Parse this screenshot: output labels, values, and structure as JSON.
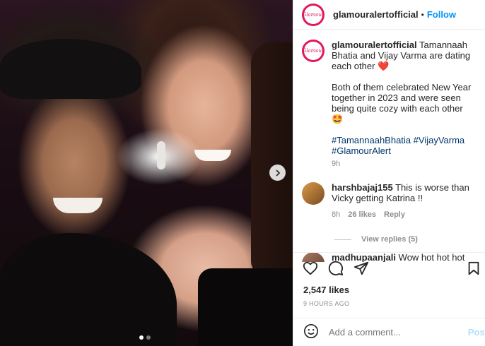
{
  "post": {
    "username": "glamouralertofficial",
    "separator": "•",
    "follow_label": "Follow",
    "avatar_logo_text": "Glamour"
  },
  "caption": {
    "username": "glamouralertofficial",
    "text1": "Tamannaah Bhatia and Vijay Varma are dating each other",
    "text2": "Both of them celebrated New Year together in 2023 and were seen being quite cozy with each other",
    "hashtags": [
      "#TamannaahBhatia",
      "#VijayVarma",
      "#GlamourAlert"
    ],
    "time": "9h"
  },
  "comments": [
    {
      "username": "harshbajaj155",
      "text": "This is worse than Vicky getting Katrina !!",
      "time": "8h",
      "likes": "26 likes",
      "reply_label": "Reply",
      "view_replies": "View replies (5)"
    },
    {
      "username": "madhupaanjali",
      "text": "Wow hot hot hot"
    }
  ],
  "engagement": {
    "likes": "2,547 likes",
    "time_ago": "9 HOURS AGO"
  },
  "add_comment": {
    "placeholder": "Add a comment...",
    "post_label": "Post"
  },
  "colors": {
    "accent": "#0095f6",
    "brand": "#e2175c",
    "heart": "#ed4956"
  }
}
